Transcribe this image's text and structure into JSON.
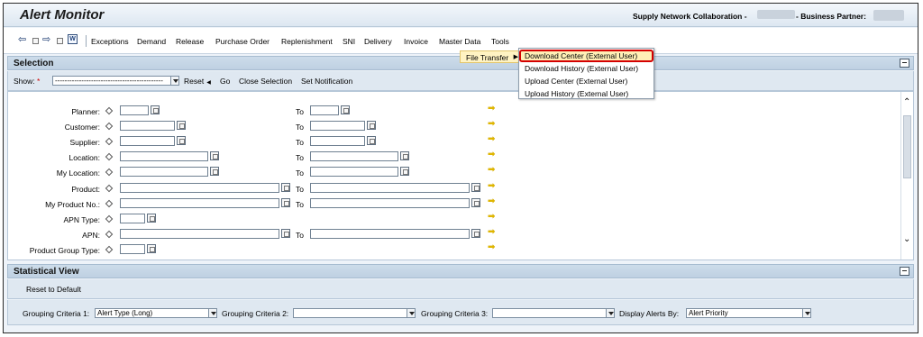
{
  "app": {
    "title": "Alert Monitor",
    "snc_label": "Supply Network Collaboration -",
    "bp_label": "- Business Partner:"
  },
  "menu": {
    "items": [
      "Exceptions",
      "Demand",
      "Release",
      "Purchase Order",
      "Replenishment",
      "SNI",
      "Delivery",
      "Invoice",
      "Master Data",
      "Tools"
    ]
  },
  "tools_menu": {
    "file_transfer": "File Transfer",
    "submenu": [
      "Download Center (External User)",
      "Download History (External User)",
      "Upload Center (External User)",
      "Upload History (External User)"
    ]
  },
  "selection": {
    "title": "Selection",
    "show_label": "Show:",
    "show_required": "*",
    "show_value": "---------------------------------------------",
    "reset": "Reset",
    "go": "Go",
    "close_selection": "Close Selection",
    "set_notification": "Set Notification",
    "to_label": "To",
    "fields": [
      "Planner:",
      "Customer:",
      "Supplier:",
      "Location:",
      "My Location:",
      "Product:",
      "My Product No.:",
      "APN Type:",
      "APN:",
      "Product Group Type:"
    ]
  },
  "statistical_view": {
    "title": "Statistical View",
    "reset_default": "Reset to Default",
    "grouping1_label": "Grouping Criteria 1:",
    "grouping1_value": "Alert Type (Long)",
    "grouping2_label": "Grouping Criteria 2:",
    "grouping2_value": "",
    "grouping3_label": "Grouping Criteria 3:",
    "grouping3_value": "",
    "display_by_label": "Display Alerts By:",
    "display_by_value": "Alert Priority"
  },
  "colors": {
    "accent": "#bfd0e2",
    "highlight": "#d40000",
    "arrow": "#e0b600"
  }
}
